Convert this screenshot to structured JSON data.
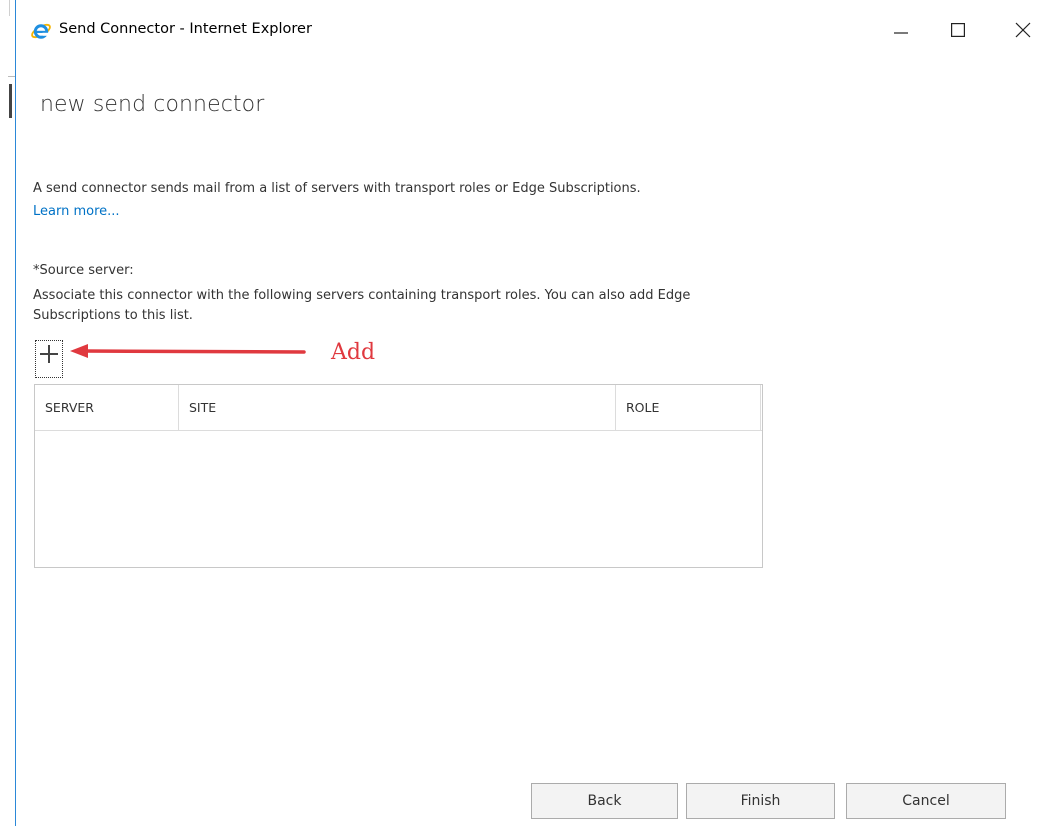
{
  "window": {
    "title": "Send Connector - Internet Explorer",
    "icon": "internet-explorer-icon",
    "controls": [
      "minimize-icon",
      "maximize-icon",
      "close-icon"
    ]
  },
  "page": {
    "title": "new send connector",
    "description": "A send connector sends mail from a list of servers with transport roles or Edge Subscriptions.",
    "learn_more": "Learn more..."
  },
  "source_server": {
    "label": "*Source server:",
    "description": "Associate this connector with the following servers containing transport roles. You can also add Edge Subscriptions to this list.",
    "add_icon": "plus-icon"
  },
  "annotation": {
    "text": "Add",
    "color": "#e0393f"
  },
  "table": {
    "columns": [
      "SERVER",
      "SITE",
      "ROLE"
    ],
    "rows": []
  },
  "footer": {
    "back": "Back",
    "finish": "Finish",
    "cancel": "Cancel"
  },
  "colors": {
    "link": "#0072c6",
    "window_edge": "#2b88d8",
    "button_bg": "#f3f3f3"
  }
}
